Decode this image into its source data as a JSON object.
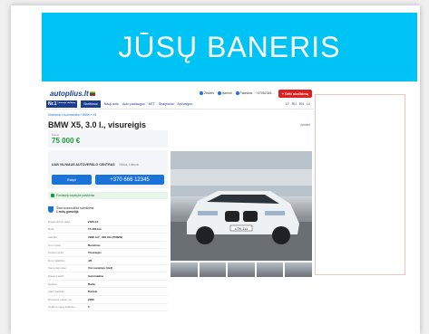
{
  "banner": {
    "text": "JŪSŲ BANERIS"
  },
  "header": {
    "logo": "autoplius.lt",
    "links": [
      "Žinutės",
      "Įsiminti",
      "Paieškos"
    ],
    "phone": "+37062345…",
    "post_button": "+ Dėti skelbimą"
  },
  "nav": {
    "badge_main": "Nr.1",
    "badge_sub": "Lietuvoje skelbimų",
    "items": [
      "Skelbimai",
      "Nauji auto",
      "Auto paslaugos",
      "KET",
      "Straipsniai",
      "Apžvalgos"
    ],
    "langs": [
      "LT",
      "RU",
      "EN",
      "LV"
    ]
  },
  "breadcrumb": "Skelbimai » Automobiliai » BMW » X5",
  "listing": {
    "title": "BMW X5, 3.0 l., visureigis",
    "views_text": "peržiūrų · Atnaujinta",
    "save_label": "Įsiminti",
    "price_label": "Kaina",
    "price": "75 000 €",
    "seller_name": "UAB VILNIAUS AUTOVERSLO CENTRAS",
    "seller_location": "Vilnius, Lietuva",
    "button_write": "Rašyti",
    "button_phone": "+370 666 12345",
    "verified_text": "Pardavėjo tapatybė patvirtinta",
    "warranty_title": "Šiam automobiliui suteikiama",
    "warranty_sub": "1 metų garantija",
    "plate": "LTN 111"
  },
  "specs": [
    {
      "k": "Pagaminimo data",
      "v": "2020-12"
    },
    {
      "k": "Rida",
      "v": "15 480 km"
    },
    {
      "k": "Variklis",
      "v": "2998 cm³, 340 AG (250kW)"
    },
    {
      "k": "Kuro tipas",
      "v": "Benzinas"
    },
    {
      "k": "Kėbulo tipas",
      "v": "Visureigis"
    },
    {
      "k": "Durų skaičius",
      "v": "4/5"
    },
    {
      "k": "Varomieji ratai",
      "v": "Visi varantys (4x4)"
    },
    {
      "k": "Pavarų dėžė",
      "v": "Automatinė"
    },
    {
      "k": "Spalva",
      "v": "Balta"
    },
    {
      "k": "Vairo padėtis",
      "v": "Kairėje"
    },
    {
      "k": "Nuosava masė, kg",
      "v": "2000"
    },
    {
      "k": "Sėdimų vietų skaičius",
      "v": "5"
    }
  ]
}
